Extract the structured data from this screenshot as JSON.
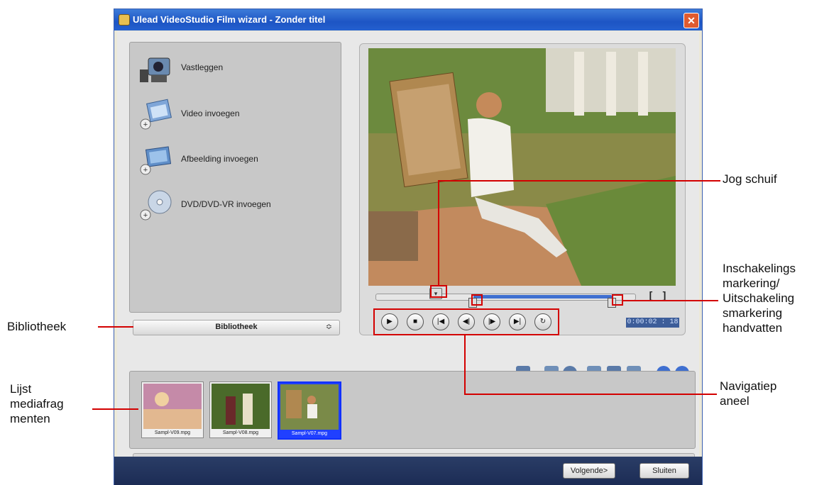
{
  "window": {
    "title": "Ulead VideoStudio Film wizard - Zonder titel",
    "close_label": "✕"
  },
  "left_panel": {
    "options": [
      {
        "label": "Vastleggen",
        "icon": "camcorder-icon"
      },
      {
        "label": "Video invoegen",
        "icon": "insert-video-icon"
      },
      {
        "label": "Afbeelding invoegen",
        "icon": "insert-image-icon"
      },
      {
        "label": "DVD/DVD-VR invoegen",
        "icon": "insert-dvd-icon"
      }
    ],
    "library_label": "Bibliotheek",
    "library_arrow": "≎"
  },
  "preview": {
    "bracket_in": "[",
    "bracket_out": "]",
    "timecode": "0:00:02 : 18",
    "nav_buttons": [
      {
        "name": "play-button",
        "glyph": "▶"
      },
      {
        "name": "stop-button",
        "glyph": "■"
      },
      {
        "name": "home-button",
        "glyph": "|◀"
      },
      {
        "name": "previous-frame-button",
        "glyph": "◀|"
      },
      {
        "name": "next-frame-button",
        "glyph": "|▶"
      },
      {
        "name": "end-button",
        "glyph": "▶|"
      },
      {
        "name": "repeat-button",
        "glyph": "↻"
      }
    ]
  },
  "clips": [
    {
      "caption": "Sampl-V09.mpg",
      "selected": false
    },
    {
      "caption": "Sampl-V08.mpg",
      "selected": false
    },
    {
      "caption": "Sampl-V07.mpg",
      "selected": true
    }
  ],
  "footer": {
    "next_label": "Volgende>",
    "close_label": "Sluiten"
  },
  "annotations": {
    "jog": "Jog schuif",
    "markers": [
      "Inschakelings",
      "markering/",
      "Uitschakeling",
      "smarkering",
      "handvatten"
    ],
    "library": "Bibliotheek",
    "clips": [
      "Lijst",
      "mediafrag",
      "menten"
    ],
    "nav": [
      "Navigatiep",
      "aneel"
    ]
  },
  "colors": {
    "annotation_red": "#d30000",
    "titlebar_blue": "#1d55c4",
    "selected_clip": "#2040ff"
  }
}
